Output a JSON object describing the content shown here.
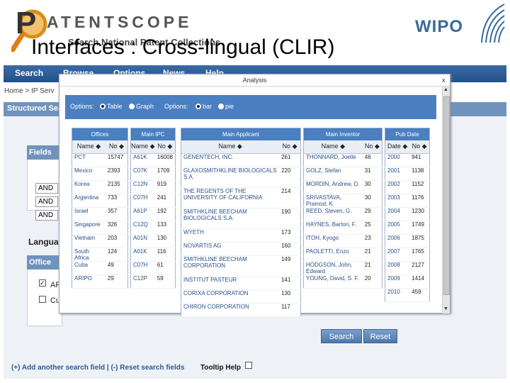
{
  "header": {
    "logo_text": "ATENTSCOPE",
    "logo_p": "P",
    "logo_subtitle": "Search National Patent Collections",
    "wipo": "WIPO",
    "slide_title": "Interfaces : Cross-lingual (CLIR)"
  },
  "nav": [
    "Search",
    "Browse",
    "Options",
    "News",
    "Help"
  ],
  "breadcrumb": "Home > IP Serv",
  "section_title": "Structured Sea",
  "fields": {
    "title": "Fields",
    "operators": [
      "AND",
      "AND",
      "AND"
    ]
  },
  "language_label": "Languag",
  "office": {
    "title": "Office",
    "items": [
      {
        "label": "AF",
        "checked": true
      },
      {
        "label": "Cu",
        "checked": false
      }
    ]
  },
  "buttons": {
    "search": "Search",
    "reset": "Reset"
  },
  "footer": {
    "links": "(+) Add another search field | (-) Reset search fields",
    "tooltip": "Tooltip Help"
  },
  "modal": {
    "title": "Analysis",
    "close": "x",
    "options1_label": "Options:",
    "opt_table": "Table",
    "opt_graph": "Graph",
    "options2_label": "Options:",
    "opt_bar": "bar",
    "opt_pie": "pie"
  },
  "tables": {
    "offices": {
      "caption": "Offices",
      "col1": "Name",
      "col2": "No",
      "rows": [
        [
          "PCT",
          "15747"
        ],
        [
          "Mexico",
          "2393"
        ],
        [
          "Korea",
          "2135"
        ],
        [
          "Argentina",
          "733"
        ],
        [
          "Israel",
          "357"
        ],
        [
          "Singapore",
          "326"
        ],
        [
          "Vietnam",
          "203"
        ],
        [
          "South Africa",
          "124"
        ],
        [
          "Cuba",
          "49"
        ],
        [
          "ARIPO",
          "29"
        ]
      ]
    },
    "ipc": {
      "caption": "Main IPC",
      "col1": "Name",
      "col2": "No",
      "rows": [
        [
          "A61K",
          "16008"
        ],
        [
          "C07K",
          "1709"
        ],
        [
          "C12N",
          "919"
        ],
        [
          "C07H",
          "241"
        ],
        [
          "A61P",
          "192"
        ],
        [
          "C12Q",
          "133"
        ],
        [
          "A01N",
          "130"
        ],
        [
          "A01K",
          "116"
        ],
        [
          "C07H",
          "61"
        ],
        [
          "C12P",
          "59"
        ]
      ]
    },
    "applicant": {
      "caption": "Main Applicant",
      "col1": "Name",
      "col2": "No",
      "rows": [
        [
          "GENENTECH, INC.",
          "261"
        ],
        [
          "GLAXOSMITHKLINE BIOLOGICALS S.A.",
          "220"
        ],
        [
          "THE REGENTS OF THE UNIVERSITY OF CALIFORNIA",
          "214"
        ],
        [
          "SMITHKLINE BEECHAM BIOLOGICALS S.A.",
          "190"
        ],
        [
          "WYETH",
          "173"
        ],
        [
          "NOVARTIS AG",
          "160"
        ],
        [
          "SMITHKLINE BEECHAM CORPORATION",
          "149"
        ],
        [
          "INSTITUT PASTEUR",
          "141"
        ],
        [
          "CORIXA CORPORATION",
          "130"
        ],
        [
          "CHIRON CORPORATION",
          "117"
        ]
      ]
    },
    "inventor": {
      "caption": "Main Inventor",
      "col1": "Name",
      "col2": "No",
      "rows": [
        [
          "THONNARD, Joelle",
          "46"
        ],
        [
          "GOLZ, Stefan",
          "31"
        ],
        [
          "MORDIN, Andrew, D.",
          "30"
        ],
        [
          "SRIVASTAVA, Pramod, K.",
          "30"
        ],
        [
          "REED, Steven, G.",
          "29"
        ],
        [
          "HAYNES, Barton, F.",
          "25"
        ],
        [
          "ITOH, Kyogo",
          "23"
        ],
        [
          "PAOLETTI, Enzo",
          "21"
        ],
        [
          "HODGSON, John, Edward",
          "21"
        ],
        [
          "YOUNG, David, S. F.",
          "20"
        ]
      ]
    },
    "pubdate": {
      "caption": "Pub Date",
      "col1": "Date",
      "col2": "No",
      "rows": [
        [
          "2000",
          "941"
        ],
        [
          "2001",
          "1138"
        ],
        [
          "2002",
          "1152"
        ],
        [
          "2003",
          "1176"
        ],
        [
          "2004",
          "1230"
        ],
        [
          "2005",
          "1749"
        ],
        [
          "2006",
          "1875"
        ],
        [
          "2007",
          "1765"
        ],
        [
          "2008",
          "2127"
        ],
        [
          "2009",
          "1414"
        ],
        [
          "2010",
          "459"
        ]
      ]
    }
  },
  "colors": {
    "nav": "#23508a",
    "panel_header": "#4a7fc1",
    "link": "#2a4f86"
  }
}
